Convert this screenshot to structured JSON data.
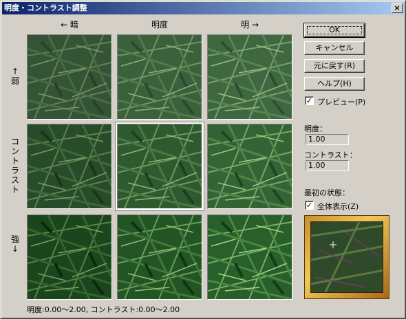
{
  "window": {
    "title": "明度・コントラスト調整",
    "close_glyph": "×"
  },
  "grid": {
    "col_headers": {
      "darker": "← 暗",
      "center": "明度",
      "brighter": "明 →"
    },
    "row_labels": {
      "weaker": "↑\n弱",
      "center": "コ\nン\nト\nラ\nス\nト",
      "stronger": "強\n↓"
    }
  },
  "buttons": {
    "ok": "OK",
    "cancel": "キャンセル",
    "revert": "元に戻す(R)",
    "help": "ヘルプ(H)"
  },
  "preview_option": {
    "label": "プレビュー(P)",
    "checked": true,
    "check_glyph": "✓"
  },
  "fields": {
    "brightness": {
      "label": "明度：",
      "value": "1.00"
    },
    "contrast": {
      "label": "コントラスト：",
      "value": "1.00"
    }
  },
  "initial_state": {
    "label": "最初の状態：",
    "show_all": {
      "label": "全体表示(Z)",
      "checked": true,
      "check_glyph": "✓"
    }
  },
  "footer": {
    "range_text": "明度:0.00～2.00, コントラスト:0.00～2.00"
  },
  "colors": {
    "titlebar_start": "#0a246a",
    "titlebar_end": "#a6caf0",
    "face": "#d4d0c8",
    "foliage": "#3c6a3a"
  }
}
